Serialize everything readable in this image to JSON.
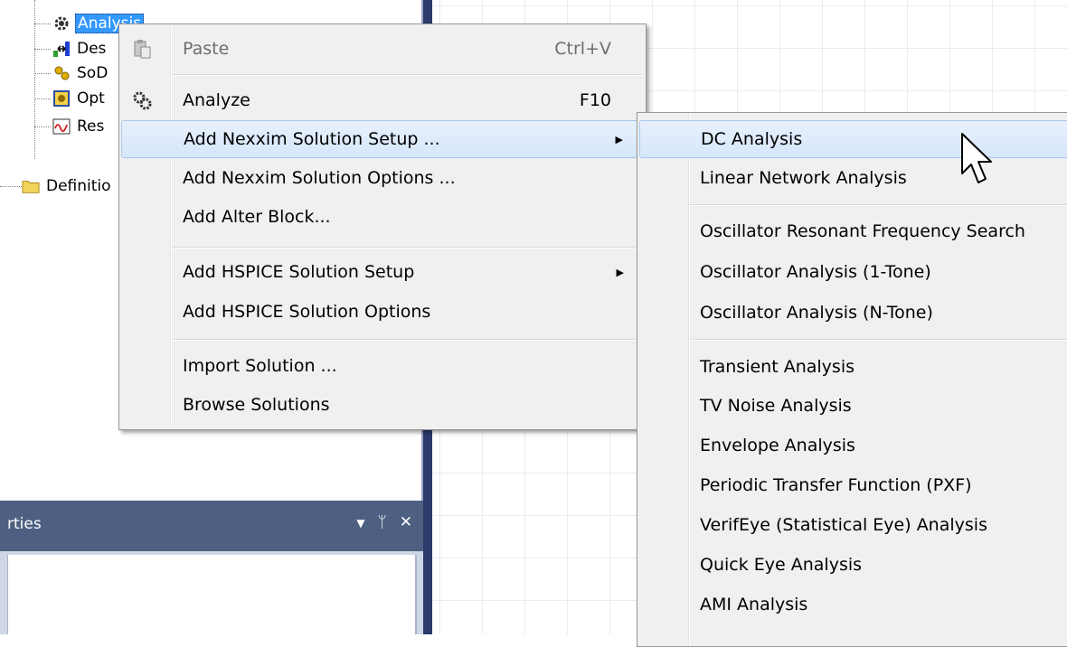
{
  "tree": {
    "items": [
      {
        "label": "Analysis",
        "icon": "gear-icon"
      },
      {
        "label": "Des",
        "icon": "design-icon"
      },
      {
        "label": "SoD",
        "icon": "gears-icon"
      },
      {
        "label": "Opt",
        "icon": "optimetrics-icon"
      },
      {
        "label": "Res",
        "icon": "results-icon"
      },
      {
        "label": "Definitio",
        "icon": "folder-icon"
      }
    ]
  },
  "properties": {
    "title": "rties",
    "controls": {
      "dropdown": "▼",
      "pin": "ᛘ",
      "close": "✕"
    }
  },
  "context_menu": {
    "items": [
      {
        "label": "Paste",
        "shortcut": "Ctrl+V"
      },
      {
        "label": "Analyze",
        "shortcut": "F10"
      },
      {
        "label": "Add Nexxim Solution Setup ..."
      },
      {
        "label": "Add Nexxim Solution Options ..."
      },
      {
        "label": "Add Alter Block..."
      },
      {
        "label": "Add HSPICE Solution Setup"
      },
      {
        "label": "Add HSPICE Solution Options"
      },
      {
        "label": "Import Solution ..."
      },
      {
        "label": "Browse Solutions"
      }
    ]
  },
  "submenu": {
    "items": [
      "DC Analysis",
      "Linear Network Analysis",
      "Oscillator Resonant Frequency Search",
      "Oscillator Analysis (1-Tone)",
      "Oscillator Analysis (N-Tone)",
      "Transient Analysis",
      "TV Noise Analysis",
      "Envelope Analysis",
      "Periodic Transfer Function (PXF)",
      "VerifEye (Statistical Eye) Analysis",
      "Quick Eye Analysis",
      "AMI Analysis"
    ]
  },
  "colors": {
    "selection": "#3399ff",
    "splitter": "#2b3a6b",
    "panel_header": "#4d6082",
    "menu_background": "#f0f0f0",
    "menu_highlight": "#d6e6fb"
  }
}
